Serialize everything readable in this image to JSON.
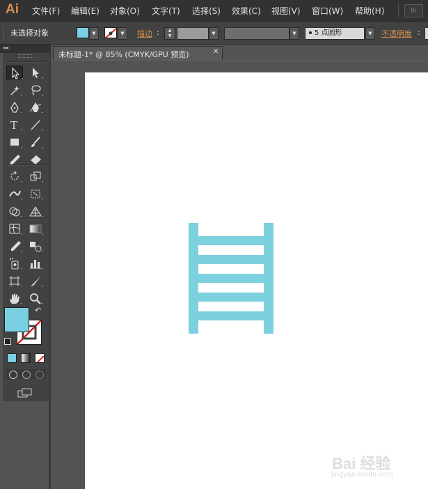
{
  "app": {
    "logo": "Ai",
    "bridge_button": "Br"
  },
  "menu": [
    "文件(F)",
    "编辑(E)",
    "对象(O)",
    "文字(T)",
    "选择(S)",
    "效果(C)",
    "视图(V)",
    "窗口(W)",
    "帮助(H)"
  ],
  "control": {
    "selection_status": "未选择对象",
    "stroke_label": "描边",
    "brush_size": "5",
    "brush_name": "点圆形",
    "opacity_label": "不透明度"
  },
  "colors": {
    "fill": "#7acfe0",
    "stroke": "none",
    "accent": "#d18f4e",
    "ladder": "#7dd0de"
  },
  "document": {
    "tab_title": "未标题-1* @ 85% (CMYK/GPU 预览)"
  },
  "tools": [
    "selection-tool",
    "direct-selection-tool",
    "magic-wand-tool",
    "lasso-tool",
    "pen-tool",
    "curvature-pen-tool",
    "type-tool",
    "line-segment-tool",
    "rectangle-tool",
    "paintbrush-tool",
    "pencil-tool",
    "eraser-tool",
    "rotate-tool",
    "scale-tool",
    "width-tool",
    "free-transform-tool",
    "shape-builder-tool",
    "perspective-grid-tool",
    "mesh-tool",
    "gradient-tool",
    "eyedropper-tool",
    "blend-tool",
    "symbol-sprayer-tool",
    "column-graph-tool",
    "artboard-tool",
    "slice-tool",
    "hand-tool",
    "zoom-tool"
  ],
  "watermark": {
    "main": "Bai 经验",
    "sub": "jingyan.baidu.com"
  }
}
